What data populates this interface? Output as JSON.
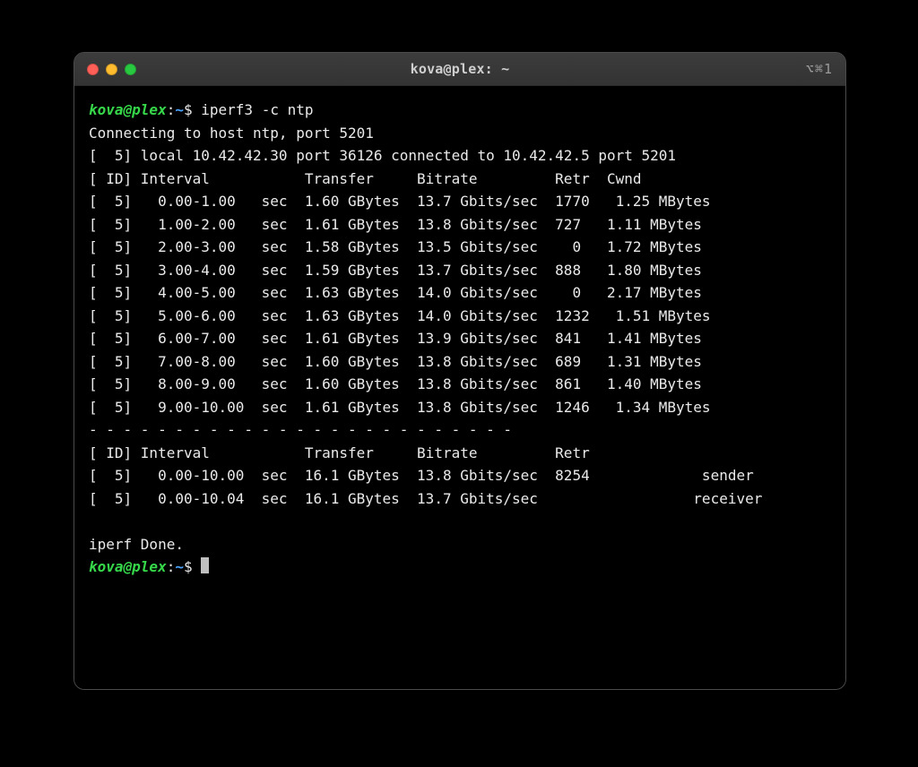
{
  "window": {
    "title": "kova@plex: ~",
    "shortcut_hint": "⌥⌘1"
  },
  "prompt": {
    "user_host": "kova@plex",
    "sep": ":",
    "path": "~",
    "symbol": "$"
  },
  "command": "iperf3 -c ntp",
  "output": {
    "connect_line": "Connecting to host ntp, port 5201",
    "local_line": "[  5] local 10.42.42.30 port 36126 connected to 10.42.42.5 port 5201",
    "header": "[ ID] Interval           Transfer     Bitrate         Retr  Cwnd",
    "rows": [
      "[  5]   0.00-1.00   sec  1.60 GBytes  13.7 Gbits/sec  1770   1.25 MBytes",
      "[  5]   1.00-2.00   sec  1.61 GBytes  13.8 Gbits/sec  727   1.11 MBytes",
      "[  5]   2.00-3.00   sec  1.58 GBytes  13.5 Gbits/sec    0   1.72 MBytes",
      "[  5]   3.00-4.00   sec  1.59 GBytes  13.7 Gbits/sec  888   1.80 MBytes",
      "[  5]   4.00-5.00   sec  1.63 GBytes  14.0 Gbits/sec    0   2.17 MBytes",
      "[  5]   5.00-6.00   sec  1.63 GBytes  14.0 Gbits/sec  1232   1.51 MBytes",
      "[  5]   6.00-7.00   sec  1.61 GBytes  13.9 Gbits/sec  841   1.41 MBytes",
      "[  5]   7.00-8.00   sec  1.60 GBytes  13.8 Gbits/sec  689   1.31 MBytes",
      "[  5]   8.00-9.00   sec  1.60 GBytes  13.8 Gbits/sec  861   1.40 MBytes",
      "[  5]   9.00-10.00  sec  1.61 GBytes  13.8 Gbits/sec  1246   1.34 MBytes"
    ],
    "separator": "- - - - - - - - - - - - - - - - - - - - - - - - -",
    "summary_header": "[ ID] Interval           Transfer     Bitrate         Retr",
    "summary_sender": "[  5]   0.00-10.00  sec  16.1 GBytes  13.8 Gbits/sec  8254             sender",
    "summary_receiver": "[  5]   0.00-10.04  sec  16.1 GBytes  13.7 Gbits/sec                  receiver",
    "done": "iperf Done."
  }
}
